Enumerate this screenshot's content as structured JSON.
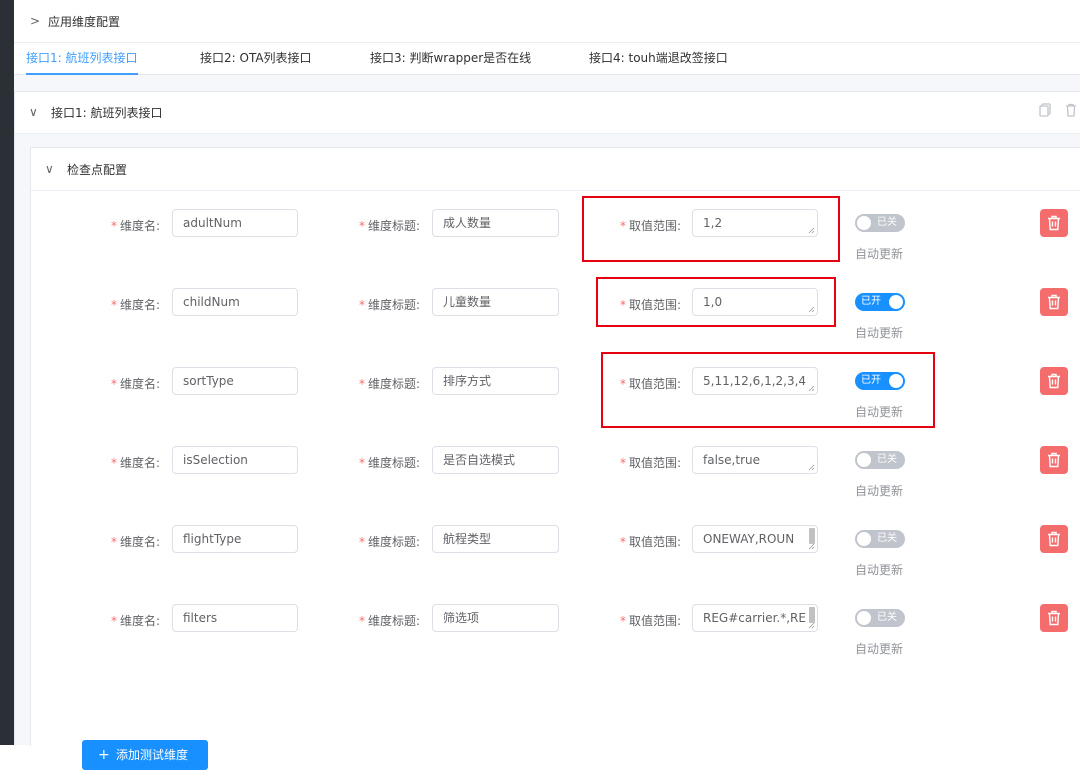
{
  "header": {
    "chevron": "chevron-right-icon",
    "title": "应用维度配置"
  },
  "tabs": [
    {
      "label": "接口1: 航班列表接口",
      "active": true
    },
    {
      "label": "接口2: OTA列表接口",
      "active": false
    },
    {
      "label": "接口3: 判断wrapper是否在线",
      "active": false
    },
    {
      "label": "接口4: touh端退改签接口",
      "active": false
    }
  ],
  "interface_panel": {
    "title": "接口1: 航班列表接口",
    "actions": [
      "copy-icon",
      "trash-icon"
    ]
  },
  "check_panel": {
    "title": "检查点配置"
  },
  "labels": {
    "name": "维度名:",
    "title": "维度标题:",
    "range": "取值范围:",
    "auto_update": "自动更新",
    "required_mark": "*"
  },
  "rows": [
    {
      "name": "adultNum",
      "title": "成人数量",
      "range": "1,2",
      "switch_on": false,
      "switch_text": "已关",
      "highlighted": true
    },
    {
      "name": "childNum",
      "title": "儿童数量",
      "range": "1,0",
      "switch_on": true,
      "switch_text": "已开",
      "highlighted": true
    },
    {
      "name": "sortType",
      "title": "排序方式",
      "range": "5,11,12,6,1,2,3,4",
      "switch_on": true,
      "switch_text": "已开",
      "highlighted": true
    },
    {
      "name": "isSelection",
      "title": "是否自选模式",
      "range": "false,true",
      "switch_on": false,
      "switch_text": "已关",
      "highlighted": false
    },
    {
      "name": "flightType",
      "title": "航程类型",
      "range": "ONEWAY,ROUN",
      "switch_on": false,
      "switch_text": "已关",
      "highlighted": false
    },
    {
      "name": "filters",
      "title": "筛选项",
      "range": "REG#carrier.*,RE",
      "switch_on": false,
      "switch_text": "已关",
      "highlighted": false
    }
  ],
  "add_button": {
    "label": "添加测试维度",
    "icon": "plus-icon"
  },
  "colors": {
    "primary": "#1890ff",
    "tab_active": "#409eff",
    "danger": "#f56c6c",
    "highlight_box": "#e60012",
    "switch_off": "#c0c4cc"
  }
}
